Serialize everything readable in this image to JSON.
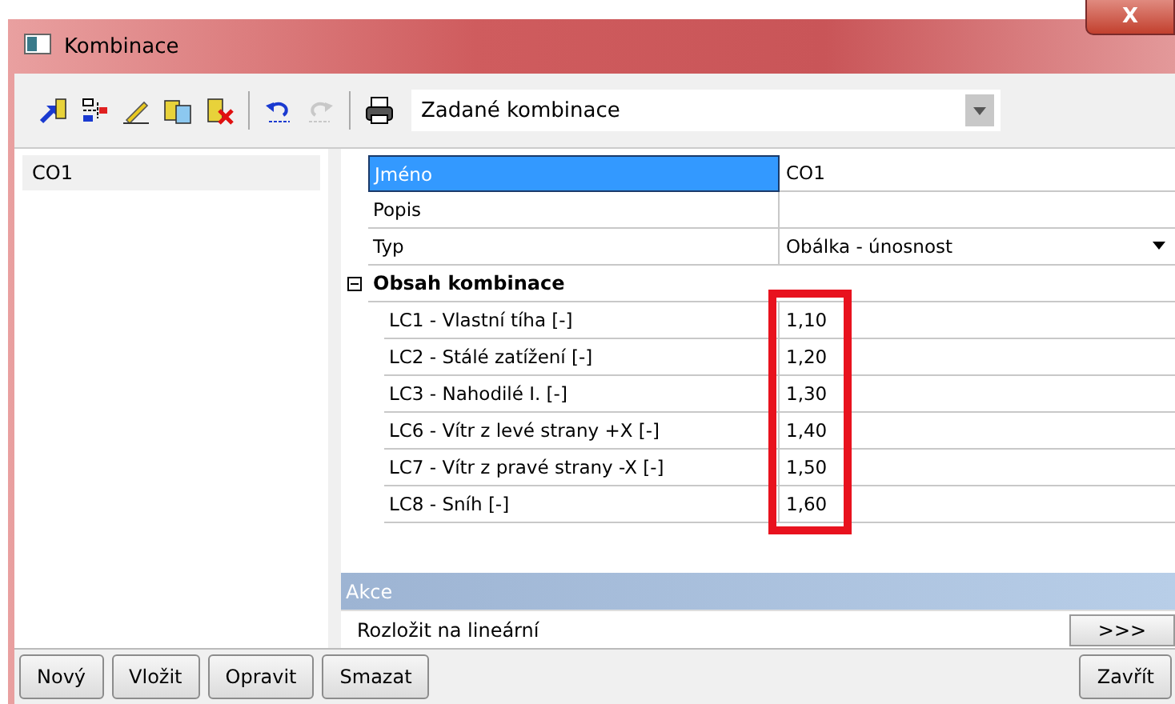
{
  "window": {
    "title": "Kombinace",
    "close": "X"
  },
  "toolbar": [
    {
      "kind": "tool",
      "disabled": false
    },
    {
      "kind": "tool",
      "disabled": false
    },
    {
      "kind": "tool",
      "disabled": false
    },
    {
      "kind": "tool",
      "disabled": false
    },
    {
      "kind": "tool",
      "disabled": false
    },
    {
      "kind": "separator"
    },
    {
      "kind": "tool",
      "disabled": false
    },
    {
      "kind": "tool",
      "disabled": true
    },
    {
      "kind": "separator"
    },
    {
      "kind": "tool",
      "disabled": false
    }
  ],
  "filter": {
    "value": "Zadané kombinace"
  },
  "list": [
    {
      "label": "CO1",
      "selected": true
    }
  ],
  "properties": [
    {
      "kind": "field",
      "label": "Jméno",
      "value": "CO1",
      "selected": true
    },
    {
      "kind": "field",
      "label": "Popis",
      "selected": false
    },
    {
      "kind": "dropdown",
      "label": "Typ",
      "value": "Obálka - únosnost",
      "selected": false
    },
    {
      "kind": "group",
      "label": "Obsah kombinace",
      "expanded": true,
      "children": [
        {
          "label": "LC1 - Vlastní tíha [-]",
          "value": "1,10"
        },
        {
          "label": "LC2 - Stálé zatížení [-]",
          "value": "1,20"
        },
        {
          "label": "LC3 - Nahodilé I. [-]",
          "value": "1,30"
        },
        {
          "label": "LC6 - Vítr z levé strany +X [-]",
          "value": "1,40"
        },
        {
          "label": "LC7 - Vítr z pravé strany -X [-]",
          "value": "1,50"
        },
        {
          "label": "LC8 - Sníh [-]",
          "value": "1,60"
        }
      ]
    }
  ],
  "values_highlighted": true,
  "actions": {
    "title": "Akce",
    "items": [
      {
        "label": "Rozložit na lineární",
        "button": ">>>"
      }
    ]
  },
  "buttons_left": [
    "Nový",
    "Vložit",
    "Opravit",
    "Smazat"
  ],
  "buttons_right": [
    "Zavřít"
  ]
}
